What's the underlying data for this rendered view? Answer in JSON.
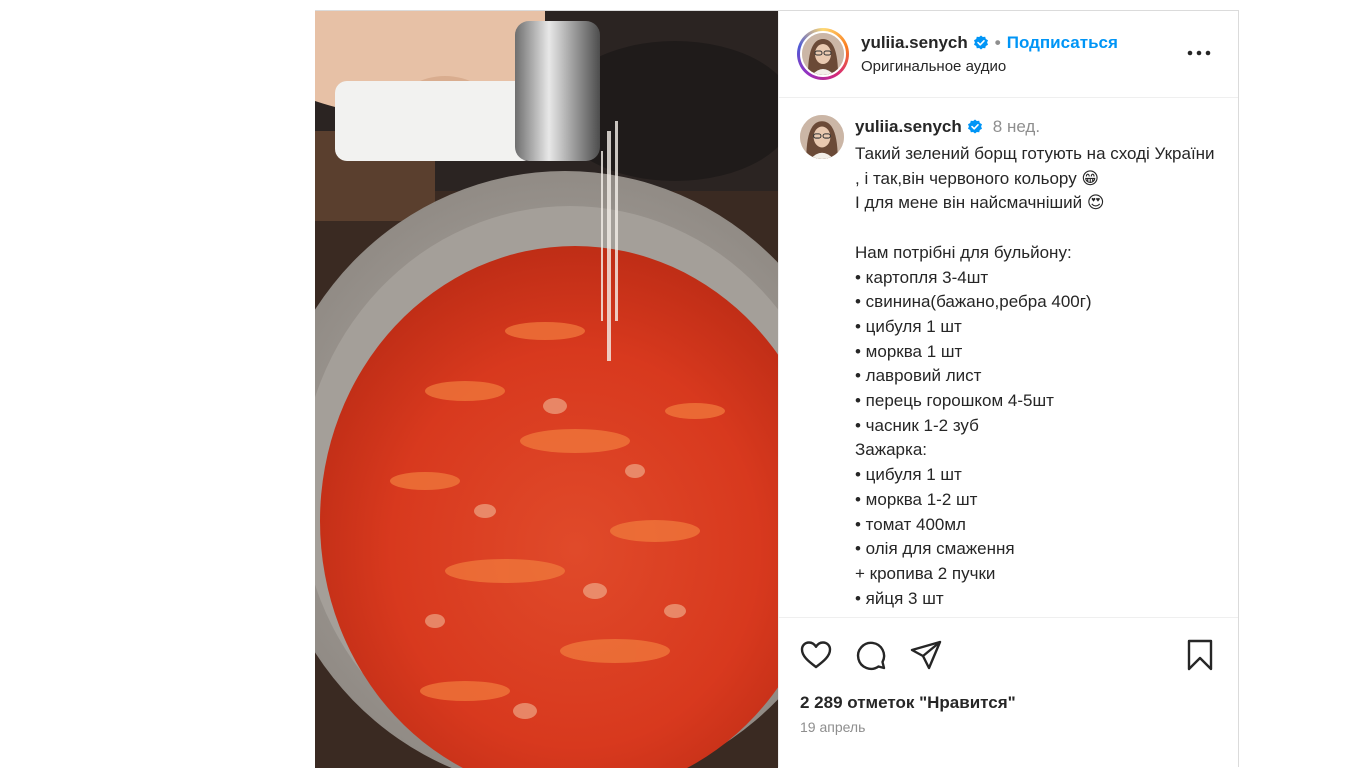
{
  "post": {
    "username": "yuliia.senych",
    "follow_label": "Подписаться",
    "separator": "•",
    "audio_label": "Оригинальное аудио",
    "comment": {
      "username": "yuliia.senych",
      "time_ago": "8 нед.",
      "caption": "Такий зелений борщ готують на сході України , і так,він червоного кольору 😁\nІ для мене він найсмачніший 😍\n\nНам потрібні для бульйону:\n• картопля 3-4шт\n• свинина(бажано,ребра 400г)\n• цибуля 1 шт\n• морква 1 шт\n• лавровий лист\n• перець горошком 4-5шт\n• часник 1-2 зуб\nЗажарка:\n• цибуля 1 шт\n• морква 1-2 шт\n• томат 400мл\n• олія для смаження\n+ кропива 2 пучки\n• яйця 3 шт"
    },
    "likes_label": "2 289 отметок \"Нравится\"",
    "date_label": "19 апрель"
  },
  "icons": {
    "verified": "verified-badge-icon",
    "more": "more-options-icon",
    "like": "heart-icon",
    "comment": "comment-icon",
    "share": "share-icon",
    "save": "bookmark-icon"
  },
  "colors": {
    "accent": "#0095f6",
    "text": "#262626",
    "muted": "#8e8e8e",
    "verified": "#0095f6"
  }
}
